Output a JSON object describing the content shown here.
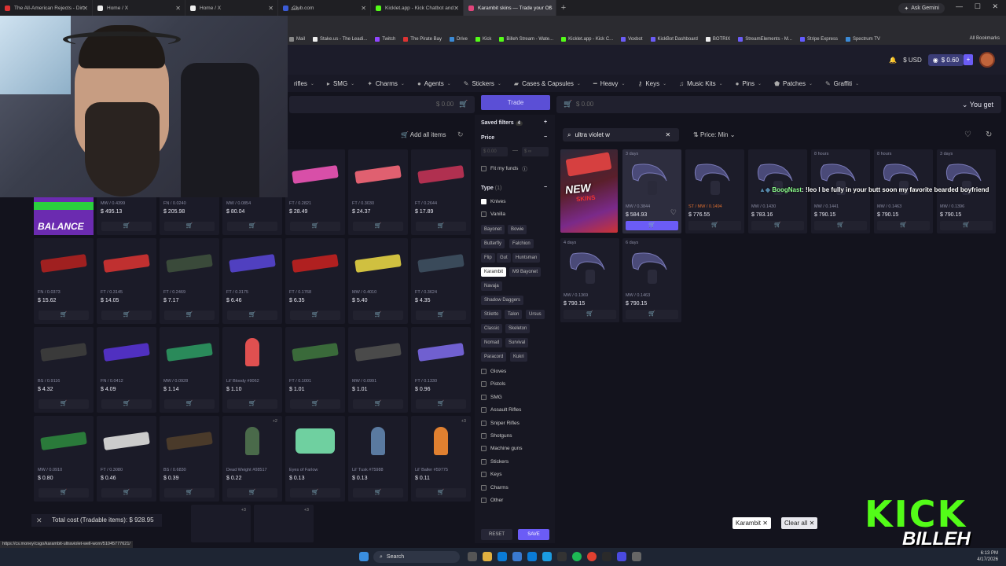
{
  "browser": {
    "tabs": [
      {
        "title": "The All-American Rejects - Dirt",
        "color": "#d33"
      },
      {
        "title": "Home / X",
        "color": "#eee"
      },
      {
        "title": "Home / X",
        "color": "#eee"
      },
      {
        "title": "Club.com",
        "color": "#3b5bd6"
      },
      {
        "title": "Kicklet.app - Kick Chatbot and",
        "color": "#53fc18"
      },
      {
        "title": "Karambit skins — Trade your CS",
        "color": "#e0457b"
      }
    ],
    "new_tab": "+",
    "ask_gemini": "Ask Gemini",
    "url": "asc",
    "bookmarks": [
      "Mail",
      "Stake.us - The Leadi...",
      "Twitch",
      "The Pirate Bay",
      "Drive",
      "Kick",
      "Billeh Stream - Wate...",
      "Kicklet.app - Kick C...",
      "Voxbot",
      "KickBot Dashboard",
      "BOTRIX",
      "StreamElements - M...",
      "Stripe Express",
      "Spectrum TV"
    ],
    "all_bookmarks": "All Bookmarks",
    "status_url": "https://cs.money/csgo/karambit-ultraviolet-well-worn/51045777621/"
  },
  "header": {
    "currency": "$ USD",
    "balance": "$ 0.60",
    "plus": "+"
  },
  "categories": [
    {
      "label": "rifles",
      "icon": ""
    },
    {
      "label": "SMG",
      "icon": "▸"
    },
    {
      "label": "Charms",
      "icon": "✦"
    },
    {
      "label": "Agents",
      "icon": "●"
    },
    {
      "label": "Stickers",
      "icon": "✎"
    },
    {
      "label": "Cases & Capsules",
      "icon": "▰"
    },
    {
      "label": "Heavy",
      "icon": "━"
    },
    {
      "label": "Keys",
      "icon": "⚷"
    },
    {
      "label": "Music Kits",
      "icon": "♫"
    },
    {
      "label": "Pins",
      "icon": "●"
    },
    {
      "label": "Patches",
      "icon": "⬟"
    },
    {
      "label": "Graffiti",
      "icon": "✎"
    }
  ],
  "left_panel": {
    "price": "$ 0.00",
    "add_all": "Add all items",
    "rows": [
      [
        {
          "wear": "MW / 0.4399",
          "price": "$ 495.13",
          "color": "#6b2bb0",
          "kind": "gun"
        },
        {
          "wear": "FN / 0.0240",
          "price": "$ 205.98",
          "color": "#444",
          "kind": "gun"
        },
        {
          "wear": "MW / 0.0854",
          "price": "$ 80.04",
          "color": "#555",
          "kind": "gun"
        },
        {
          "wear": "FT / 0.2821",
          "price": "$ 28.49",
          "color": "#d84fa8",
          "kind": "gun"
        },
        {
          "wear": "FT / 0.3030",
          "price": "$ 24.37",
          "color": "#e06070",
          "kind": "gun"
        },
        {
          "wear": "FT / 0.2644",
          "price": "$ 17.89",
          "color": "#b03050",
          "kind": "gun"
        }
      ],
      [
        {
          "wear": "FN / 0.0373",
          "price": "$ 15.62",
          "color": "#a02020",
          "kind": "gun"
        },
        {
          "wear": "FT / 0.3145",
          "price": "$ 14.05",
          "color": "#c03030",
          "kind": "gun"
        },
        {
          "wear": "FT / 0.2469",
          "price": "$ 7.17",
          "color": "#3a4a3a",
          "kind": "gun"
        },
        {
          "wear": "FT / 0.3175",
          "price": "$ 6.46",
          "color": "#5040c0",
          "kind": "gun"
        },
        {
          "wear": "FT / 0.1768",
          "price": "$ 6.35",
          "color": "#b02020",
          "kind": "gun"
        },
        {
          "wear": "MW / 0.4010",
          "price": "$ 5.40",
          "color": "#d0c040",
          "kind": "gun"
        },
        {
          "wear": "FT / 0.3624",
          "price": "$ 4.35",
          "color": "#3a4a5a",
          "kind": "gun"
        }
      ],
      [
        {
          "wear": "BS / 0.9116",
          "price": "$ 4.32",
          "color": "#3a3a3a",
          "kind": "gun"
        },
        {
          "wear": "FN / 0.0412",
          "price": "$ 4.09",
          "color": "#5030c0",
          "kind": "gun"
        },
        {
          "wear": "MW / 0.0928",
          "price": "$ 1.14",
          "color": "#2a8a5a",
          "kind": "gun"
        },
        {
          "wear": "Lil' Bloody #9062",
          "price": "$ 1.10",
          "color": "#e05050",
          "kind": "figure"
        },
        {
          "wear": "FT / 0.1001",
          "price": "$ 1.01",
          "color": "#3a6a3a",
          "kind": "gun",
          "st": "ST"
        },
        {
          "wear": "MW / 0.0991",
          "price": "$ 1.01",
          "color": "#4a4a4a",
          "kind": "gun"
        },
        {
          "wear": "FT / 0.1330",
          "price": "$ 0.96",
          "color": "#7060d0",
          "kind": "gun"
        }
      ],
      [
        {
          "wear": "MW / 0.0910",
          "price": "$ 0.80",
          "color": "#2a7a3a",
          "kind": "gun"
        },
        {
          "wear": "FT / 0.3080",
          "price": "$ 0.46",
          "color": "#ccc",
          "kind": "gun"
        },
        {
          "wear": "BS / 0.6830",
          "price": "$ 0.39",
          "color": "#4a3a2a",
          "kind": "gun"
        },
        {
          "wear": "Dead Weight #08517",
          "price": "$ 0.22",
          "color": "#4a6a4a",
          "kind": "figure",
          "badge": "+2"
        },
        {
          "wear": "Eyes of Farlow",
          "price": "$ 0.13",
          "color": "#6fd0a0",
          "kind": "sticker"
        },
        {
          "wear": "Lil' Tusk #75988",
          "price": "$ 0.13",
          "color": "#5a7aa0",
          "kind": "figure"
        },
        {
          "wear": "Lil' Baller #59775",
          "price": "$ 0.11",
          "color": "#e08030",
          "kind": "figure",
          "badge": "+3"
        }
      ]
    ],
    "bottom_badges": [
      "+3",
      "+3"
    ],
    "total_cost": "Total cost (Tradable items): $ 928.95",
    "close": "✕"
  },
  "filters": {
    "trade": "Trade",
    "saved_filters": "Saved filters",
    "saved_count": "4",
    "price": "Price",
    "price_min_ph": "$ 0.00",
    "price_max_ph": "$ ∞",
    "fit_my_funds": "Fit my funds",
    "type": "Type",
    "type_count": "(1)",
    "knives": "Knives",
    "vanilla": "Vanilla",
    "knife_chips": [
      "Bayonet",
      "Bowie",
      "Butterfly",
      "Falchion",
      "Flip",
      "Gut",
      "Huntsman",
      "Karambit",
      "M9 Bayonet",
      "Navaja",
      "Shadow Daggers",
      "Stiletto",
      "Talon",
      "Ursus",
      "Classic",
      "Skeleton",
      "Nomad",
      "Survival",
      "Paracord",
      "Kukri"
    ],
    "selected_chip": "Karambit",
    "types": [
      "Gloves",
      "Pistols",
      "SMG",
      "Assault Rifles",
      "Sniper Rifles",
      "Shotguns",
      "Machine guns",
      "Stickers",
      "Keys",
      "Charms",
      "Other"
    ],
    "reset": "RESET",
    "save": "SAVE"
  },
  "right_panel": {
    "price": "$ 0.00",
    "you_get": "You get",
    "search_value": "ultra violet w",
    "sort": "Price: Min",
    "promo_new": "NEW",
    "promo_skins": "SKINS",
    "items": [
      {
        "lock": "3 days",
        "wear": "MW / 0.3844",
        "price": "$ 584.93",
        "hl": true
      },
      {
        "lock": "",
        "wear": "ST / MW / 0.1494",
        "price": "$ 776.55",
        "st": "ST"
      },
      {
        "lock": "",
        "wear": "MW / 0.1430",
        "price": "$ 783.16"
      },
      {
        "lock": "8 hours",
        "wear": "MW / 0.1441",
        "price": "$ 790.15"
      },
      {
        "lock": "8 hours",
        "wear": "MW / 0.1463",
        "price": "$ 790.15"
      },
      {
        "lock": "3 days",
        "wear": "MW / 0.1396",
        "price": "$ 790.15"
      },
      {
        "lock": "4 days",
        "wear": "MW / 0.1369",
        "price": "$ 790.15"
      },
      {
        "lock": "6 days",
        "wear": "MW / 0.1463",
        "price": "$ 790.15"
      }
    ],
    "tag": "Karambit ✕",
    "clear_all": "Clear all ✕"
  },
  "chat": {
    "user": "BoogNast",
    "message": ": !leo I be fully in your butt soon my favorite bearded boyfriend"
  },
  "overlay": {
    "balance_label": "BALANCE",
    "kick": "KICK",
    "billeh": "BILLEH"
  },
  "taskbar": {
    "search": "Search",
    "time": "6:13 PM",
    "date": "4/17/2026"
  }
}
